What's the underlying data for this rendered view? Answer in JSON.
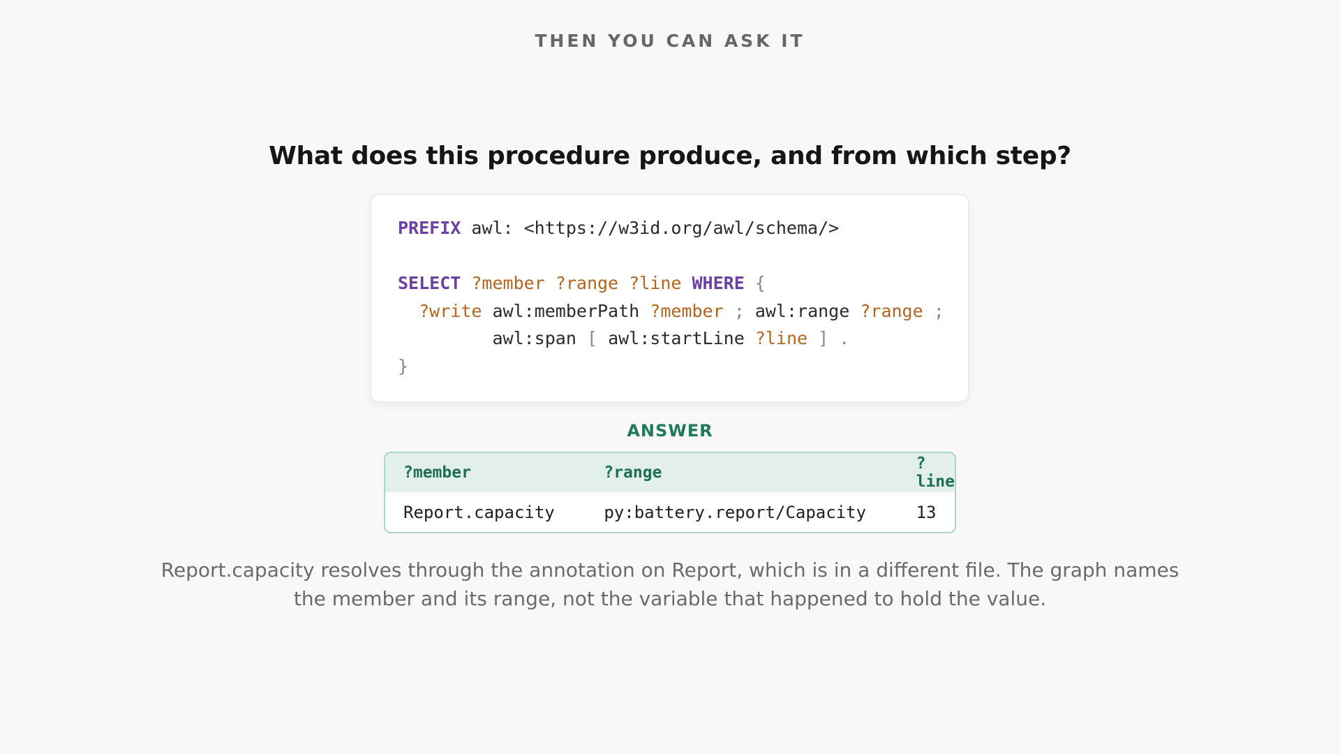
{
  "kicker": "THEN YOU CAN ASK IT",
  "question": "What does this procedure produce, and from which step?",
  "query": {
    "line1": {
      "kw_prefix": "PREFIX",
      "prefix_rest": " awl: <https://w3id.org/awl/schema/>"
    },
    "line3": {
      "kw_select": "SELECT",
      "v_member": "?member",
      "v_range": "?range",
      "v_line": "?line",
      "kw_where": "WHERE",
      "brace_open": "{"
    },
    "line4": {
      "v_write": "?write",
      "pred_member_path": "awl:memberPath",
      "v_member": "?member",
      "semi1": ";",
      "pred_range": "awl:range",
      "v_range": "?range",
      "semi2": ";"
    },
    "line5": {
      "pred_span": "awl:span",
      "bracket_open": "[",
      "pred_start_line": "awl:startLine",
      "v_line": "?line",
      "bracket_close": "]",
      "dot": "."
    },
    "line6": {
      "brace_close": "}"
    }
  },
  "answer": {
    "label": "ANSWER",
    "columns": [
      "?member",
      "?range",
      "?line"
    ],
    "rows": [
      [
        "Report.capacity",
        "py:battery.report/Capacity",
        "13"
      ]
    ]
  },
  "caption": "Report.capacity resolves through the annotation on Report, which is in a different file. The graph names the member and its range, not the variable that happened to hold the value.",
  "colors": {
    "background": "#f9f8f6",
    "keyword": "#6b3fa3",
    "variable": "#b5651d",
    "accent": "#1e7a5a",
    "table_header_bg": "#e2efea",
    "table_border": "#a9d6c6"
  }
}
